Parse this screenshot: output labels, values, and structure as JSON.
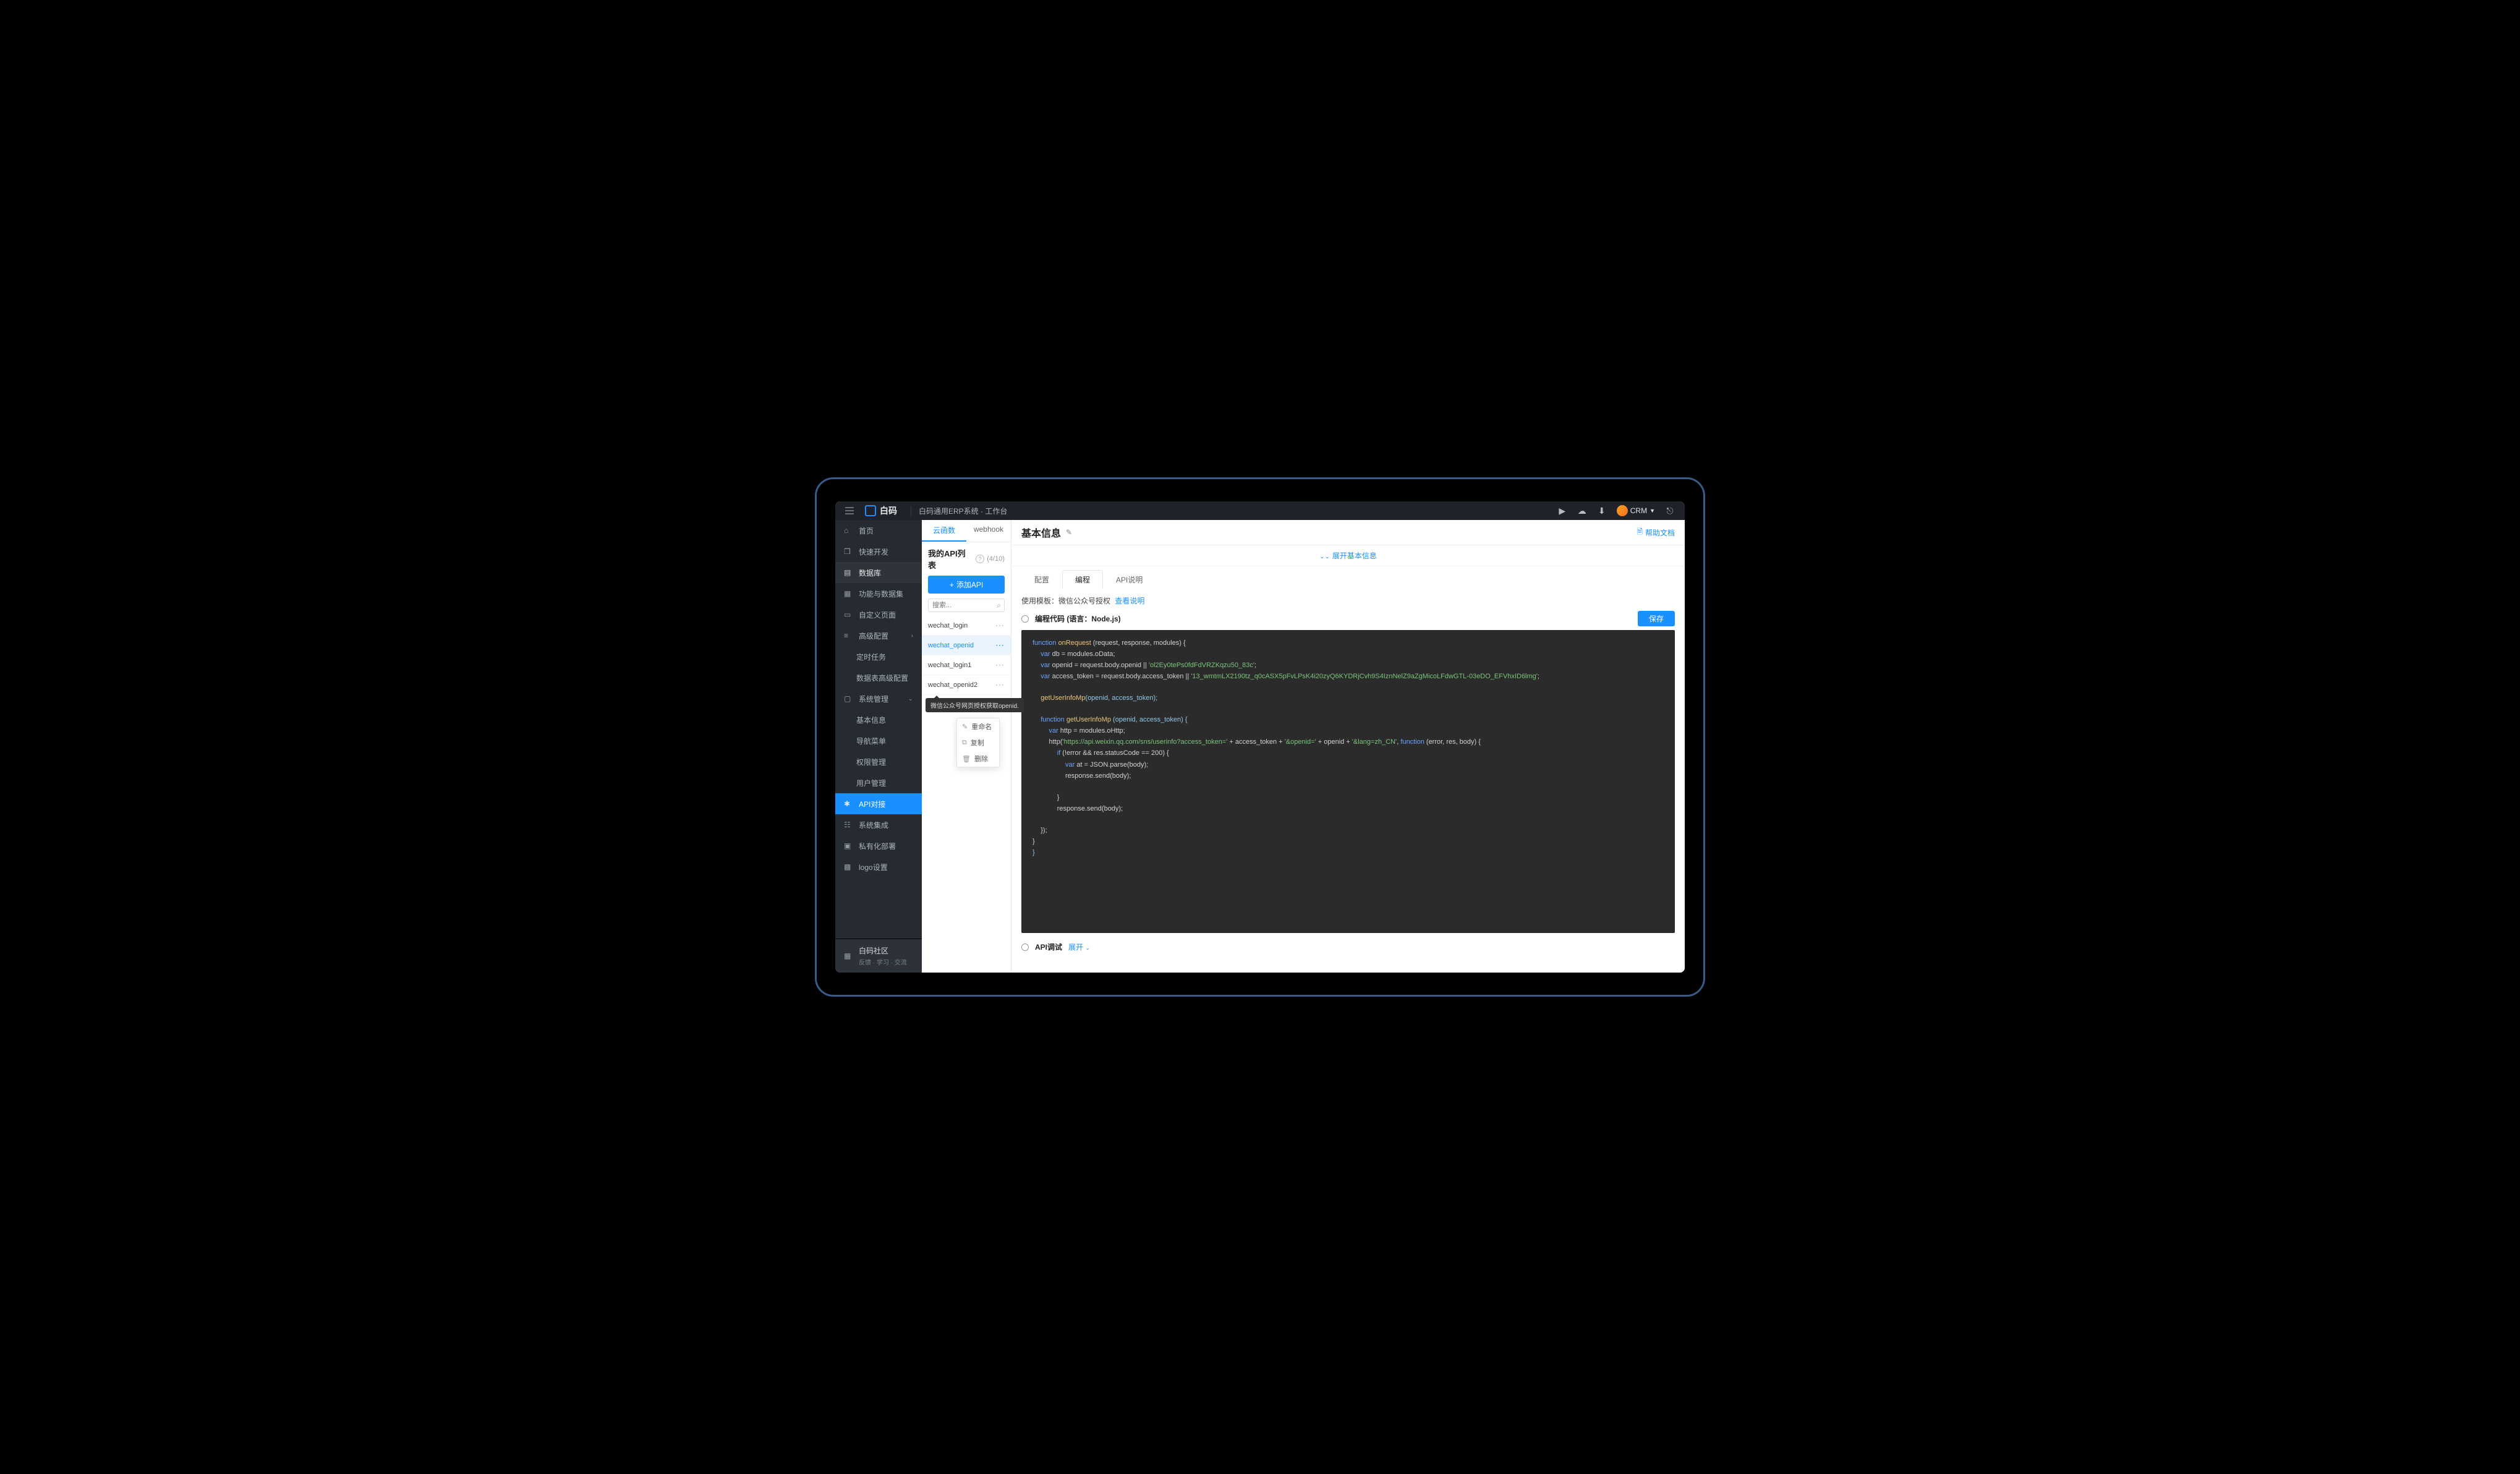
{
  "brand": {
    "name": "白码"
  },
  "breadcrumb": "白码通用ERP系统 · 工作台",
  "user": {
    "name": "CRM"
  },
  "sidebar": {
    "items": [
      {
        "label": "首页"
      },
      {
        "label": "快速开发"
      },
      {
        "label": "数据库"
      },
      {
        "label": "功能与数据集"
      },
      {
        "label": "自定义页面"
      },
      {
        "label": "高级配置"
      },
      {
        "label": "定时任务"
      },
      {
        "label": "数据表高级配置"
      },
      {
        "label": "系统管理"
      },
      {
        "label": "基本信息"
      },
      {
        "label": "导航菜单"
      },
      {
        "label": "权限管理"
      },
      {
        "label": "用户管理"
      },
      {
        "label": "API对接"
      },
      {
        "label": "系统集成"
      },
      {
        "label": "私有化部署"
      },
      {
        "label": "logo设置"
      }
    ],
    "footer": {
      "title": "白码社区",
      "subtitle": "反馈 · 学习 · 交流"
    }
  },
  "listPanel": {
    "tabs": [
      "云函数",
      "webhook"
    ],
    "title": "我的API列表",
    "counter": "(4/10)",
    "addLabel": "添加API",
    "searchPlaceholder": "搜索...",
    "items": [
      "wechat_login",
      "wechat_openid",
      "wechat_login1",
      "wechat_openid2"
    ],
    "tooltip": "微信公众号网页授权获取openid.",
    "context": {
      "rename": "重命名",
      "copy": "复制",
      "delete": "删除"
    }
  },
  "main": {
    "title": "基本信息",
    "helpLink": "帮助文档",
    "expand": "展开基本信息",
    "tabs": [
      "配置",
      "编程",
      "API说明"
    ],
    "templateLabel": "使用模板：",
    "templateName": "微信公众号授权",
    "templateLink": "查看说明",
    "codeHeader": "编程代码 (语言：Node.js)",
    "saveLabel": "保存",
    "debugTitle": "API调试",
    "debugExpand": "展开"
  },
  "code": {
    "l1": {
      "kw": "function",
      "fn": " onRequest ",
      "args": "(request, response, modules) {"
    },
    "l2": {
      "kw": "var",
      "v": " db = modules.oData;"
    },
    "l3": {
      "kw": "var",
      "v1": " openid = request.body.openid || ",
      "s": "'ol2Ey0tePs0fdFdVRZKqzu50_83c'",
      "t": ";"
    },
    "l4": {
      "kw": "var",
      "v1": " access_token = request.body.access_token || ",
      "s": "'13_wmtmLX2190tz_q0cASX5pFvLPsK4i20zyQ6KYDRjCvh9S4IznNelZ9aZgMicoLFdwGTL-03eDO_EFVhxID6lmg'",
      "t": ";"
    },
    "l6": {
      "fn": "getUserInfoMp",
      "args": "(openid, access_token);"
    },
    "l8": {
      "kw": "function",
      "fn": " getUserInfoMp ",
      "args": "(openid, access_token) {"
    },
    "l9": {
      "kw": "var",
      "v": " http = modules.oHttp;"
    },
    "l10": {
      "p1": "http(",
      "s1": "'https://api.weixin.qq.com/sns/userinfo?access_token='",
      "p2": " + access_token + ",
      "s2": "'&openid='",
      "p3": " + openid + ",
      "s3": "'&lang=zh_CN'",
      "p4": ", ",
      "kw": "function",
      "p5": " (error, res, body) {"
    },
    "l11": {
      "kw": "if",
      "v": " (!error && res.statusCode == 200) {"
    },
    "l12": {
      "kw": "var",
      "v": " at = JSON.parse(body);"
    },
    "l13": "response.send(body);",
    "l15": "}",
    "l16": "response.send(body);",
    "l18": "});",
    "l19": "}",
    "l20": "}"
  }
}
